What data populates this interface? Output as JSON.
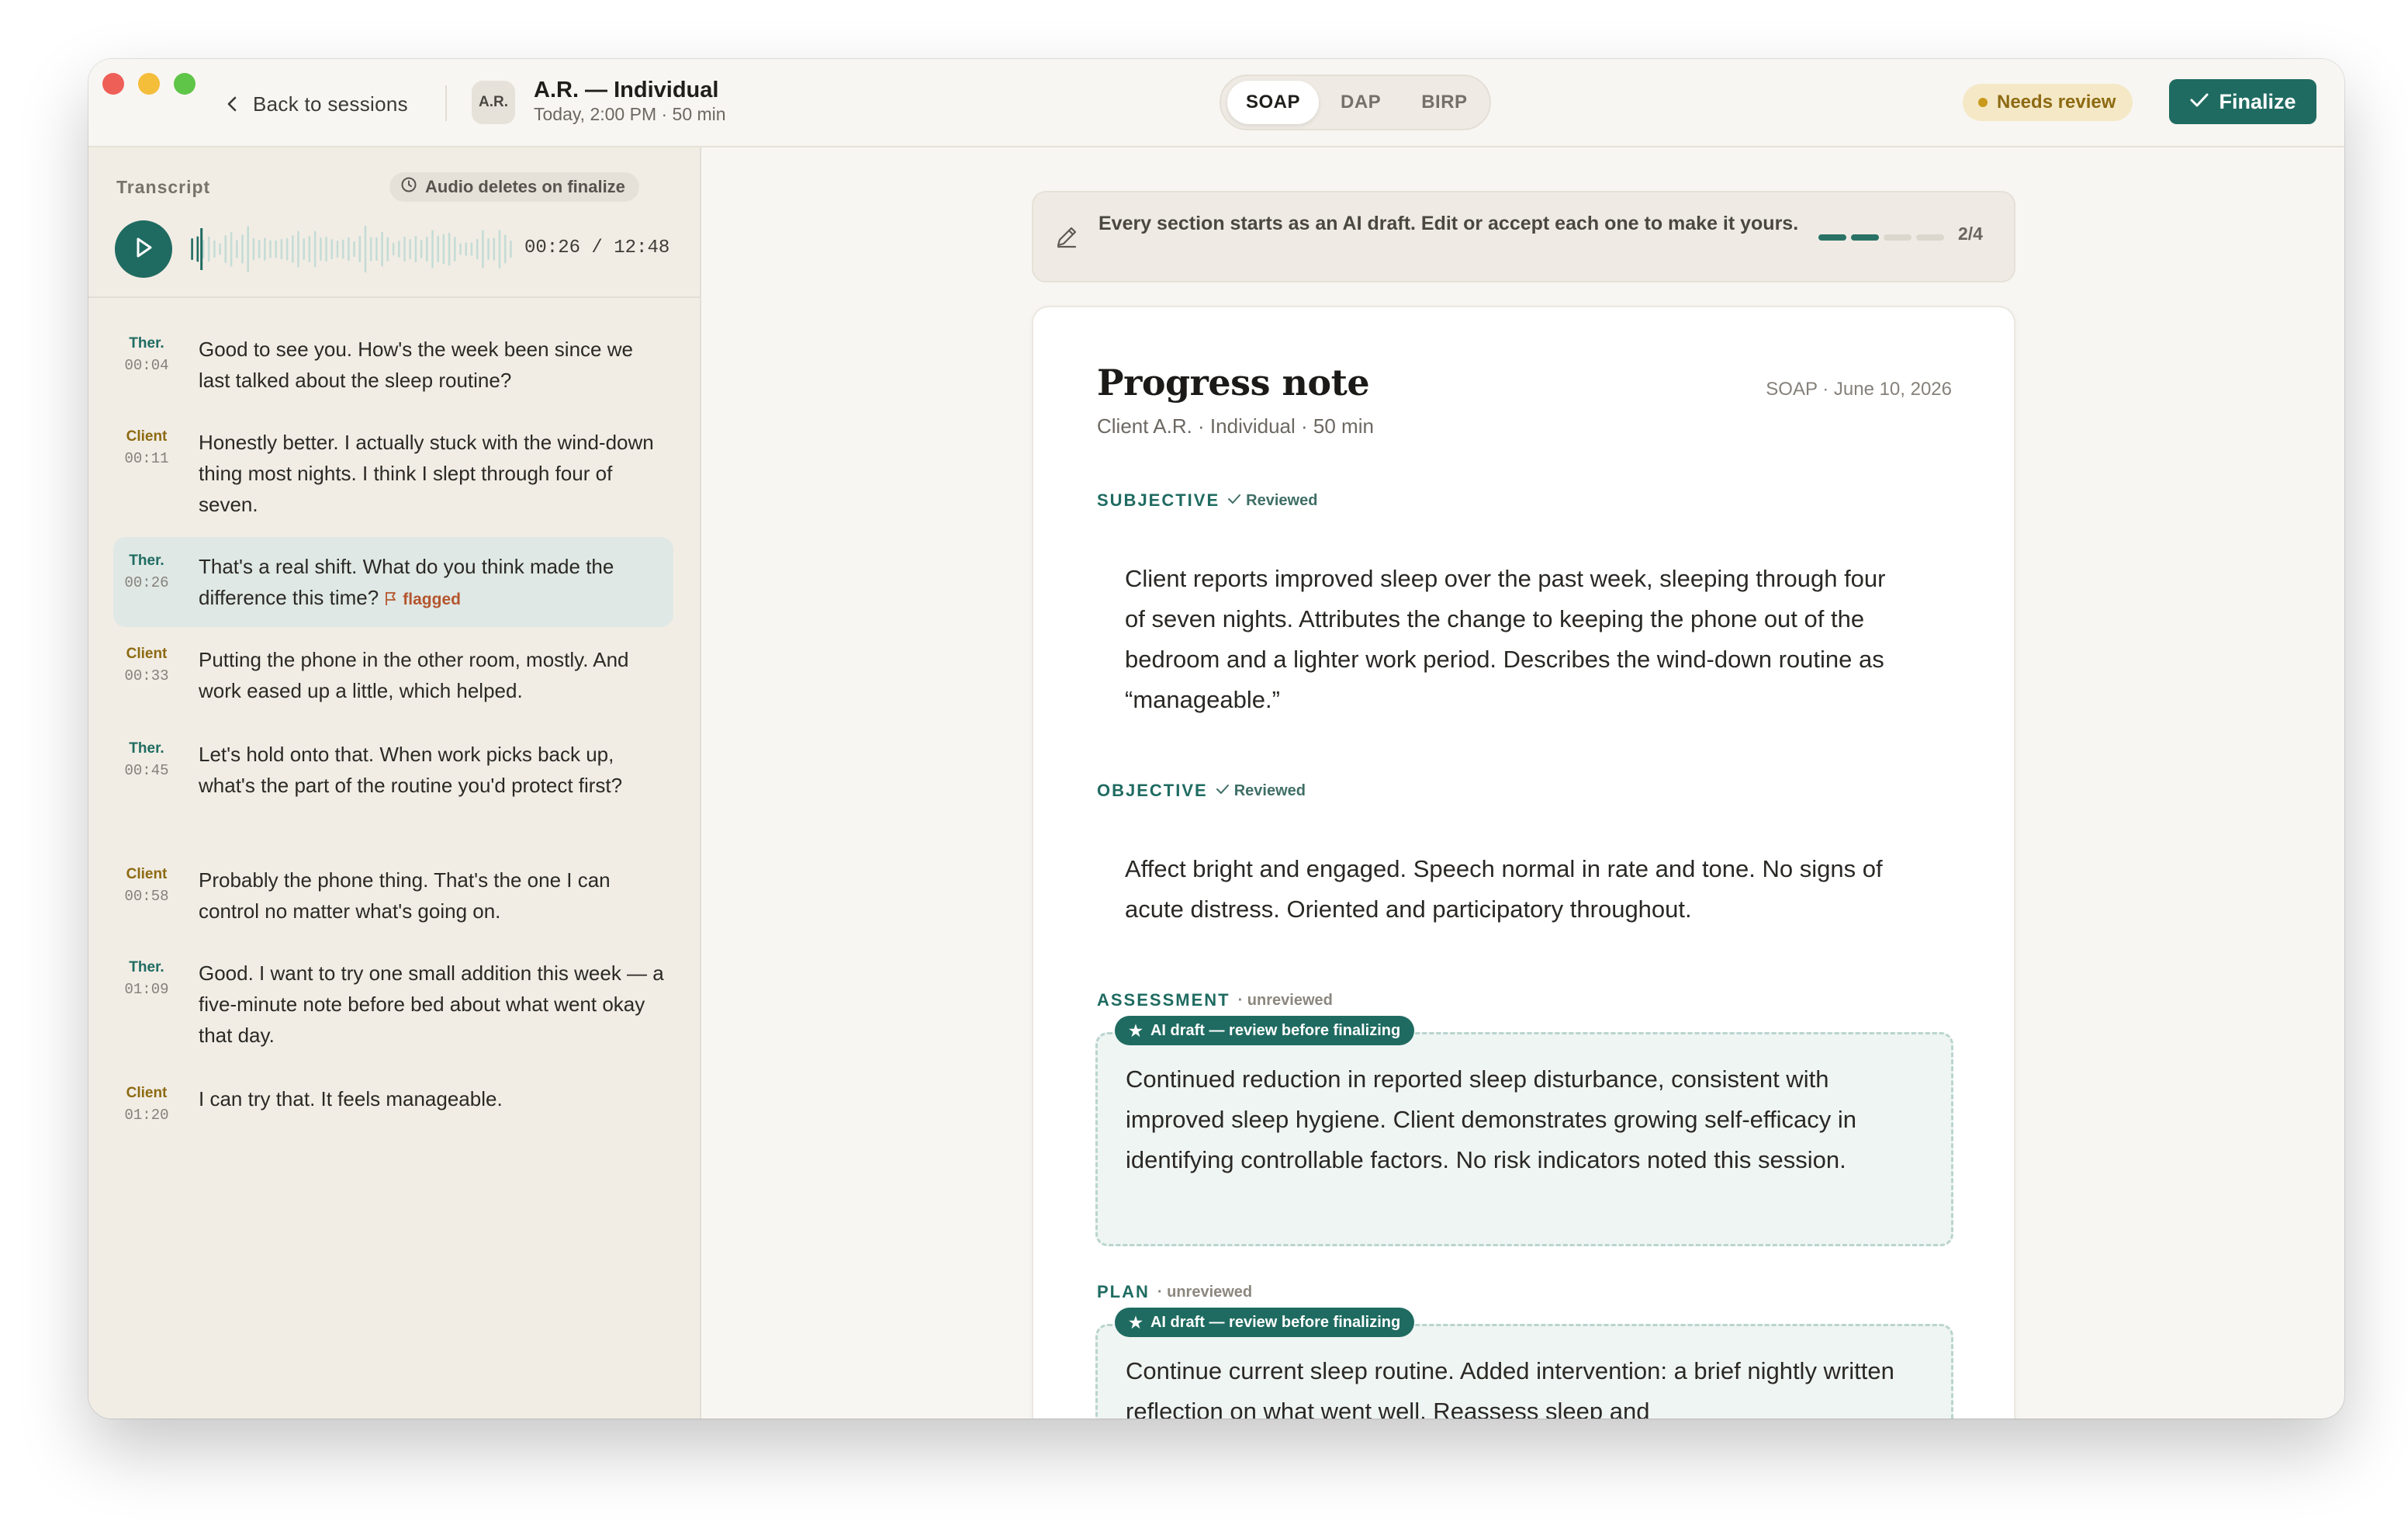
{
  "header": {
    "back_label": "Back to sessions",
    "avatar_initials": "A.R.",
    "session_title": "A.R. — Individual",
    "session_subtitle": "Today, 2:00 PM · 50 min",
    "formats": [
      "SOAP",
      "DAP",
      "BIRP"
    ],
    "active_format": "SOAP",
    "status_badge": "Needs review",
    "finalize_label": "Finalize"
  },
  "transcript": {
    "label": "Transcript",
    "audio_badge": "Audio deletes on finalize",
    "current_time": "00:26",
    "separator": "/",
    "total_time": "12:48",
    "playback_progress": 0.034,
    "entries": [
      {
        "speaker": "Ther.",
        "time": "00:04",
        "text": "Good to see you. How's the week been since we last talked about the sleep routine?"
      },
      {
        "speaker": "Client",
        "time": "00:11",
        "text": "Honestly better. I actually stuck with the wind-down thing most nights. I think I slept through four of seven."
      },
      {
        "speaker": "Ther.",
        "time": "00:26",
        "text": "That's a real shift. What do you think made the difference this time?",
        "flag": "flagged"
      },
      {
        "speaker": "Client",
        "time": "00:33",
        "text": "Putting the phone in the other room, mostly. And work eased up a little, which helped."
      },
      {
        "speaker": "Ther.",
        "time": "00:45",
        "text": "Let's hold onto that. When work picks back up, what's the part of the routine you'd protect first?"
      },
      {
        "speaker": "Client",
        "time": "00:58",
        "text": "Probably the phone thing. That's the one I can control no matter what's going on."
      },
      {
        "speaker": "Ther.",
        "time": "01:09",
        "text": "Good. I want to try one small addition this week — a five-minute note before bed about what went okay that day."
      },
      {
        "speaker": "Client",
        "time": "01:20",
        "text": "I can try that. It feels manageable."
      }
    ]
  },
  "banner": {
    "text": "Every section starts as an AI draft. Edit or accept each one to make it yours.",
    "progress_done": 2,
    "progress_total": 4,
    "progress_label": "2/4"
  },
  "note": {
    "title": "Progress note",
    "meta": "SOAP · June 10, 2026",
    "subtitle": "Client A.R. · Individual · 50 min",
    "sections": [
      {
        "label": "SUBJECTIVE",
        "status": "Reviewed",
        "draft": false,
        "body": "Client reports improved sleep over the past week, sleeping through four of seven nights. Attributes the change to keeping the phone out of the bedroom and a lighter work period. Describes the wind-down routine as “manageable.”"
      },
      {
        "label": "OBJECTIVE",
        "status": "Reviewed",
        "draft": false,
        "body": "Affect bright and engaged. Speech normal in rate and tone. No signs of acute distress. Oriented and participatory throughout."
      },
      {
        "label": "ASSESSMENT",
        "status": "· unreviewed",
        "draft": true,
        "draft_pill": "AI draft — review before finalizing",
        "body": "Continued reduction in reported sleep disturbance, consistent with improved sleep hygiene. Client demonstrates growing self-efficacy in identifying controllable factors. No risk indicators noted this session."
      },
      {
        "label": "PLAN",
        "status": "· unreviewed",
        "draft": true,
        "draft_pill": "AI draft — review before finalizing",
        "body": "Continue current sleep routine. Added intervention: a brief nightly written reflection on what went well. Reassess sleep and"
      }
    ]
  },
  "colors": {
    "accent": "#1f6b61",
    "warning_bg": "#f4e8c6",
    "warning_text": "#8d6a12",
    "flag": "#b4552d"
  }
}
